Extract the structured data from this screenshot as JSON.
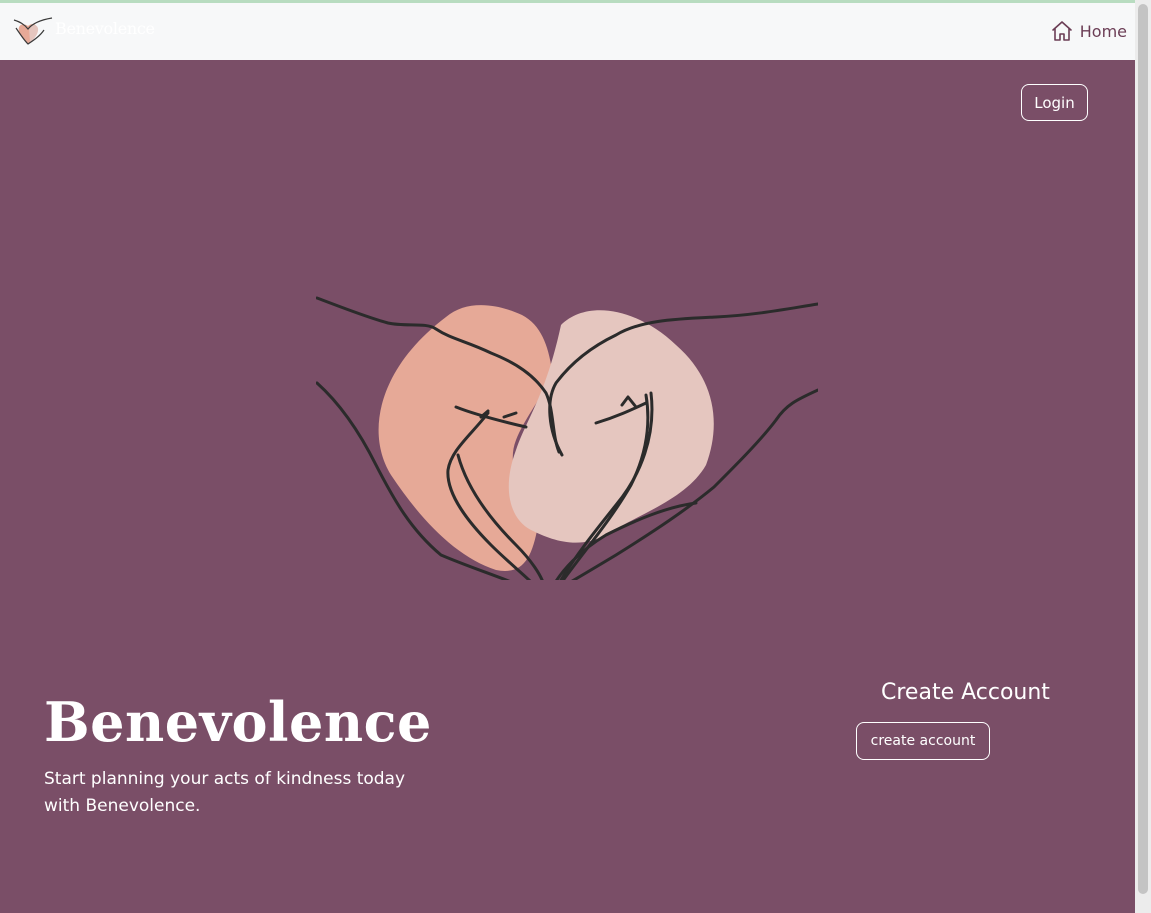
{
  "navbar": {
    "brand_name": "Benevolence",
    "brand_logo_icon": "heart-hands-logo-icon",
    "home_label": "Home",
    "home_icon": "house-icon"
  },
  "hero": {
    "login_label": "Login",
    "illustration_icon": "heart-hands-illustration",
    "title": "Benevolence",
    "subtitle": "Start planning your acts of kindness today with Benevolence.",
    "create_account_heading": "Create Account",
    "create_account_button": "create account"
  },
  "colors": {
    "hero_background": "#7a4e67",
    "navbar_background": "#f7f8f9",
    "home_link": "#6b3d55",
    "heart_blob_left": "#e6a997",
    "heart_blob_right": "#e5c6bf",
    "line_art": "#2b2b2b",
    "text": "#ffffff"
  }
}
